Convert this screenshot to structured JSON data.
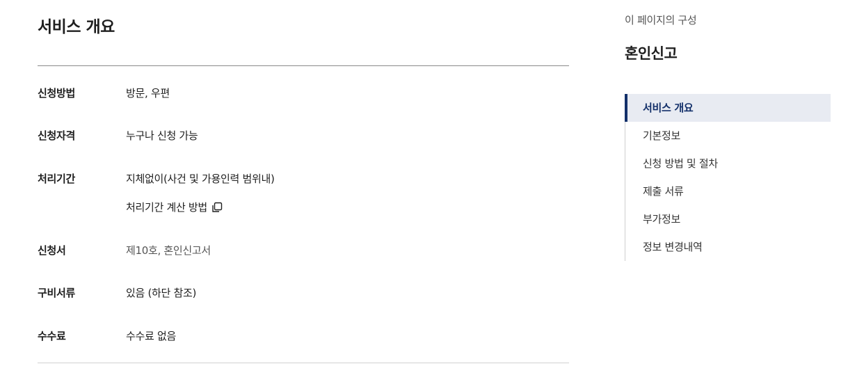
{
  "main": {
    "section_title": "서비스 개요",
    "rows": [
      {
        "label": "신청방법",
        "value": "방문, 우편"
      },
      {
        "label": "신청자격",
        "value": "누구나 신청 가능"
      },
      {
        "label": "처리기간",
        "value": "지체없이(사건 및 가용인력 범위내)",
        "link": "처리기간 계산 방법"
      },
      {
        "label": "신청서",
        "value": "제10호, 혼인신고서"
      },
      {
        "label": "구비서류",
        "value": "있음 (하단 참조)"
      },
      {
        "label": "수수료",
        "value": "수수료 없음"
      }
    ],
    "link_icon": "copy-icon"
  },
  "toc": {
    "caption": "이 페이지의 구성",
    "title": "혼인신고",
    "items": [
      {
        "label": "서비스 개요",
        "active": true
      },
      {
        "label": "기본정보"
      },
      {
        "label": "신청 방법 및 절차"
      },
      {
        "label": "제출 서류"
      },
      {
        "label": "부가정보"
      },
      {
        "label": "정보 변경내역"
      }
    ]
  },
  "colors": {
    "accent": "#13306a",
    "active_bg": "#e8ebf2",
    "text": "#1e1e1e",
    "muted": "#555555"
  }
}
